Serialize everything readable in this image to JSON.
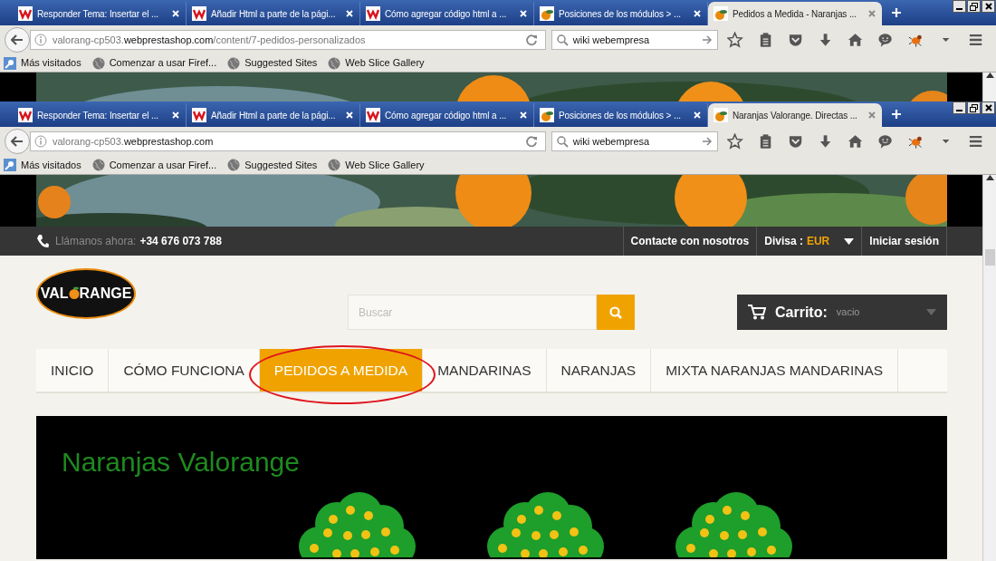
{
  "windows": [
    {
      "tabs": [
        {
          "title": "Responder Tema: Insertar el ...",
          "kind": "letter-logo",
          "selected": false
        },
        {
          "title": "Añadir Html a parte de la pági...",
          "kind": "letter-logo",
          "selected": false
        },
        {
          "title": "Cómo agregar código html a ...",
          "kind": "letter-logo",
          "selected": false
        },
        {
          "title": "Posiciones de los módulos > ...",
          "kind": "fruit",
          "selected": false
        },
        {
          "title": "Pedidos a Medida - Naranjas ...",
          "kind": "fruit",
          "selected": true
        }
      ],
      "url": {
        "prefix": "valorang-cp503.",
        "domain": "webprestashop.com",
        "path": "/content/7-pedidos-personalizados"
      },
      "search": "wiki webempresa",
      "bookmarks": [
        {
          "label": "Más visitados",
          "kind": "search"
        },
        {
          "label": "Comenzar a usar Firef...",
          "kind": "globe"
        },
        {
          "label": "Suggested Sites",
          "kind": "globe"
        },
        {
          "label": "Web Slice Gallery",
          "kind": "globe"
        }
      ]
    },
    {
      "tabs": [
        {
          "title": "Responder Tema: Insertar el ...",
          "kind": "letter-logo",
          "selected": false
        },
        {
          "title": "Añadir Html a parte de la pági...",
          "kind": "letter-logo",
          "selected": false
        },
        {
          "title": "Cómo agregar código html a ...",
          "kind": "letter-logo",
          "selected": false
        },
        {
          "title": "Posiciones de los módulos > ...",
          "kind": "fruit",
          "selected": false
        },
        {
          "title": "Naranjas Valorange. Directas ...",
          "kind": "fruit",
          "selected": true
        }
      ],
      "url": {
        "prefix": "valorang-cp503.",
        "domain": "webprestashop.com"
      },
      "search": "wiki webempresa",
      "bookmarks": [
        {
          "label": "Más visitados",
          "kind": "search"
        },
        {
          "label": "Comenzar a usar Firef...",
          "kind": "globe"
        },
        {
          "label": "Suggested Sites",
          "kind": "globe"
        },
        {
          "label": "Web Slice Gallery",
          "kind": "globe"
        }
      ]
    }
  ],
  "page": {
    "top_bar": {
      "call_label": "Llámanos ahora:",
      "phone": "+34 676 073 788",
      "contact": "Contacte con nosotros",
      "currency_label": "Divisa :",
      "currency": "EUR",
      "login": "Iniciar sesión"
    },
    "logo": {
      "left": "VAL",
      "right": "RANGE"
    },
    "search_placeholder": "Buscar",
    "cart": {
      "label": "Carrito:",
      "status": "vacio"
    },
    "menu": [
      {
        "label": "INICIO",
        "selected": false
      },
      {
        "label": "CÓMO FUNCIONA",
        "selected": false
      },
      {
        "label": "PEDIDOS A MEDIDA",
        "selected": true,
        "circled": true
      },
      {
        "label": "MANDARINAS",
        "selected": false
      },
      {
        "label": "NARANJAS",
        "selected": false
      },
      {
        "label": "MIXTA NARANJAS MANDARINAS",
        "selected": false
      }
    ],
    "banner": {
      "title": "Naranjas Valorange"
    }
  }
}
